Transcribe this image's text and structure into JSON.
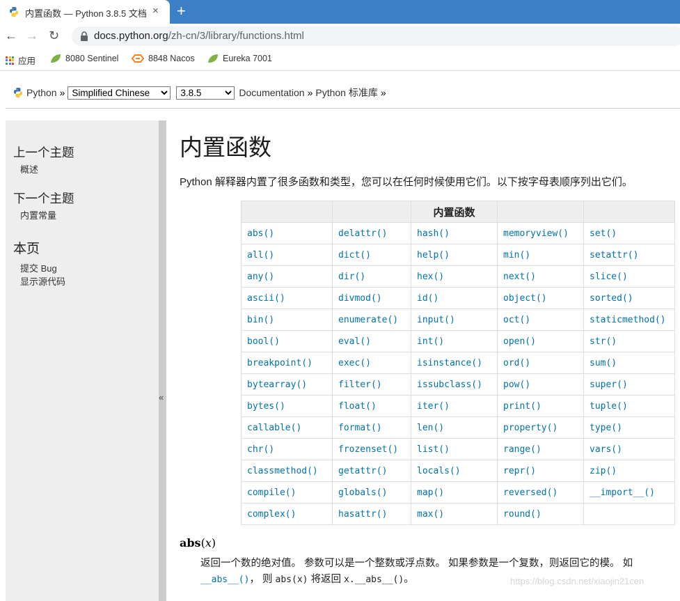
{
  "browser": {
    "tab_title": "内置函数 — Python 3.8.5 文档",
    "tab_close": "×",
    "new_tab": "+",
    "url_host": "docs.python.org",
    "url_path": "/zh-cn/3/library/functions.html",
    "back": "←",
    "forward": "→",
    "reload": "↻",
    "bookmarks": [
      "应用",
      "8080 Sentinel",
      "8848 Nacos",
      "Eureka 7001"
    ]
  },
  "breadcrumb": {
    "python": "Python",
    "sep1": "»",
    "language": "Simplified Chinese",
    "version": "3.8.5",
    "documentation": "Documentation",
    "sep2": "»",
    "stdlib": "Python 标准库",
    "sep3": "»"
  },
  "sidebar": {
    "prev_heading": "上一个主题",
    "prev_link": "概述",
    "next_heading": "下一个主题",
    "next_link": "内置常量",
    "this_page_heading": "本页",
    "report_bug": "提交 Bug",
    "show_source": "显示源代码",
    "collapse": "«"
  },
  "main": {
    "title": "内置函数",
    "intro": "Python 解释器内置了很多函数和类型，您可以在任何时候使用它们。以下按字母表顺序列出它们。",
    "table_header": "内置函数",
    "functions": [
      [
        "abs()",
        "delattr()",
        "hash()",
        "memoryview()",
        "set()"
      ],
      [
        "all()",
        "dict()",
        "help()",
        "min()",
        "setattr()"
      ],
      [
        "any()",
        "dir()",
        "hex()",
        "next()",
        "slice()"
      ],
      [
        "ascii()",
        "divmod()",
        "id()",
        "object()",
        "sorted()"
      ],
      [
        "bin()",
        "enumerate()",
        "input()",
        "oct()",
        "staticmethod()"
      ],
      [
        "bool()",
        "eval()",
        "int()",
        "open()",
        "str()"
      ],
      [
        "breakpoint()",
        "exec()",
        "isinstance()",
        "ord()",
        "sum()"
      ],
      [
        "bytearray()",
        "filter()",
        "issubclass()",
        "pow()",
        "super()"
      ],
      [
        "bytes()",
        "float()",
        "iter()",
        "print()",
        "tuple()"
      ],
      [
        "callable()",
        "format()",
        "len()",
        "property()",
        "type()"
      ],
      [
        "chr()",
        "frozenset()",
        "list()",
        "range()",
        "vars()"
      ],
      [
        "classmethod()",
        "getattr()",
        "locals()",
        "repr()",
        "zip()"
      ],
      [
        "compile()",
        "globals()",
        "map()",
        "reversed()",
        "__import__()"
      ],
      [
        "complex()",
        "hasattr()",
        "max()",
        "round()",
        ""
      ]
    ],
    "abs_name": "abs",
    "abs_open": "(",
    "abs_param": "x",
    "abs_close": ")",
    "abs_desc": "返回一个数的绝对值。 参数可以是一个整数或浮点数。 如果参数是一个复数，则返回它的模。 如",
    "abs_desc2_link": "__abs__()",
    "abs_desc2_mid": "， 则",
    "abs_desc2_code1": "abs(x)",
    "abs_desc2_mid2": "将返回",
    "abs_desc2_code2": "x.__abs__()",
    "abs_desc2_end": "。"
  },
  "watermark": "https://blog.csdn.net/xiaojin21cen"
}
